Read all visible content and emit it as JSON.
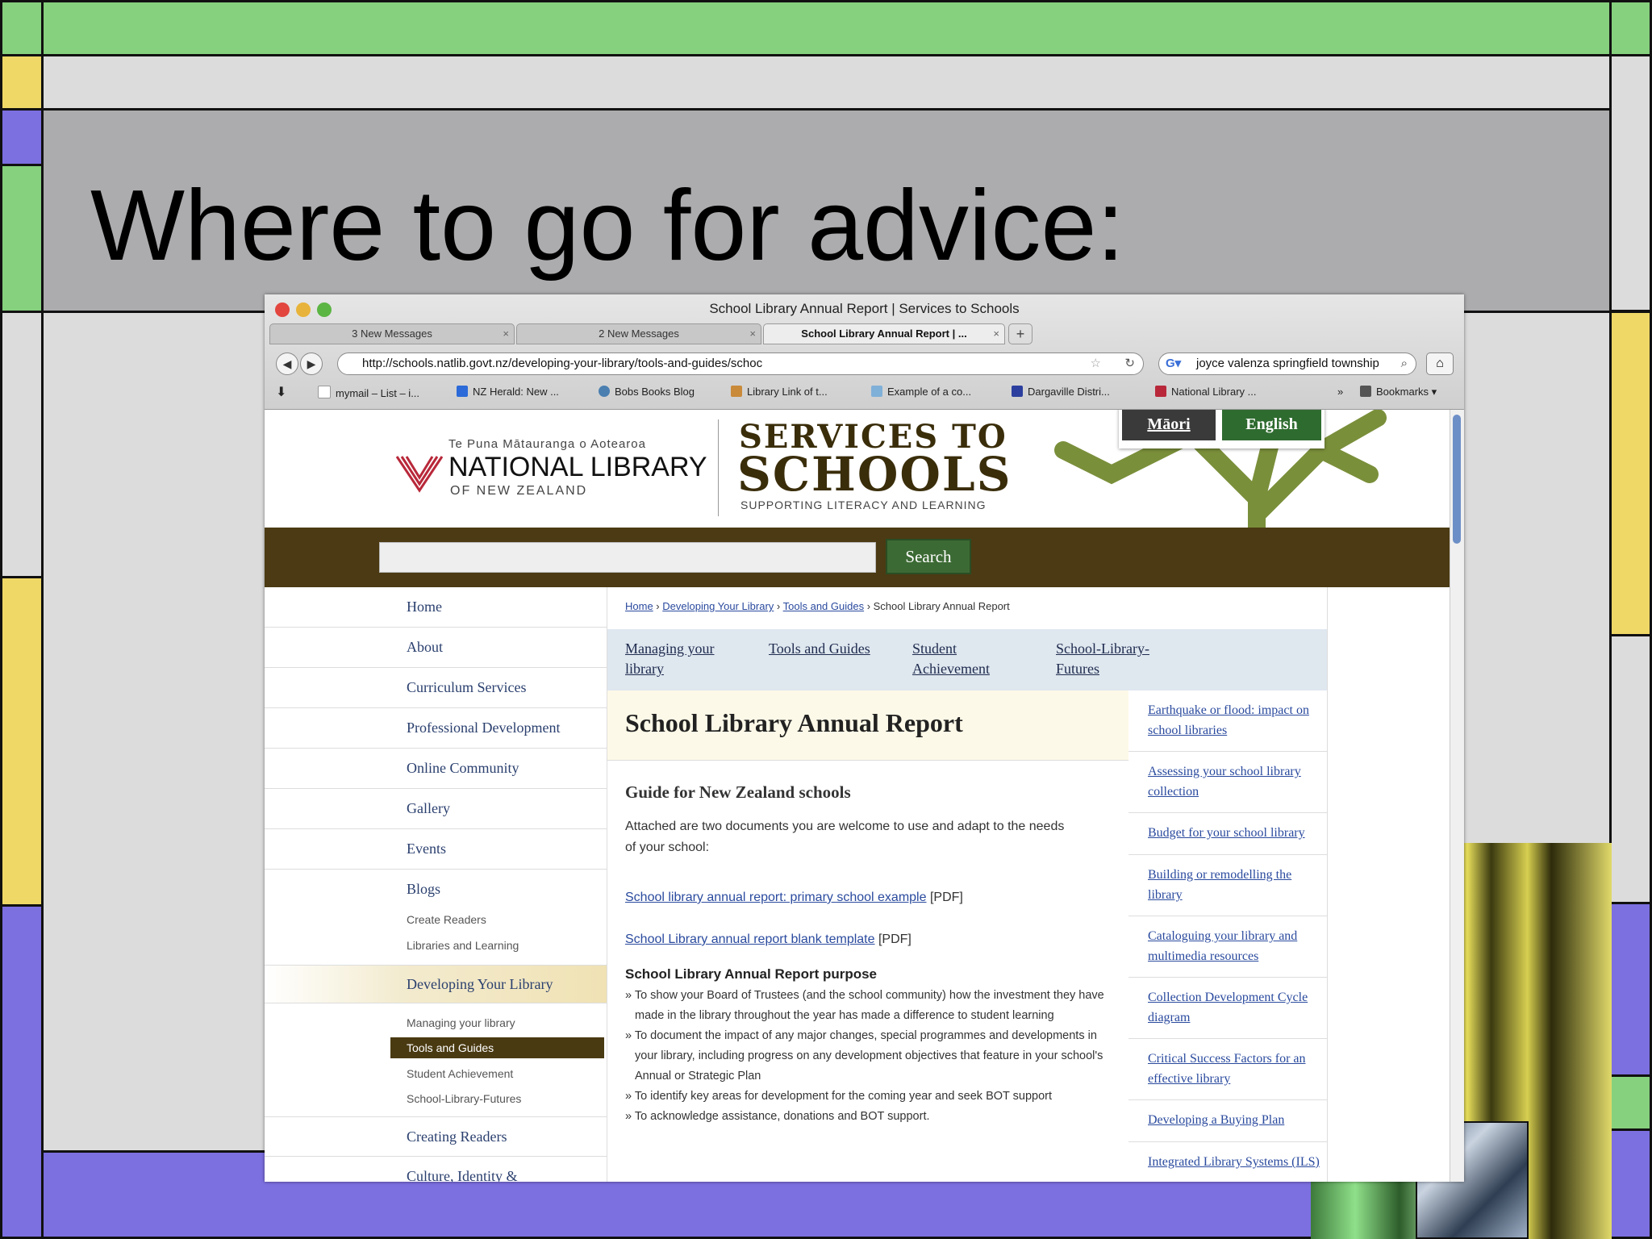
{
  "slide": {
    "title": "Where to go for advice:"
  },
  "browser": {
    "window_title": "School Library Annual Report | Services to Schools",
    "tabs": [
      {
        "label": "3 New Messages",
        "active": false
      },
      {
        "label": "2 New Messages",
        "active": false
      },
      {
        "label": "School Library Annual Report | ...",
        "active": true
      }
    ],
    "url": "http://schools.natlib.govt.nz/developing-your-library/tools-and-guides/schoc",
    "search_query": "joyce valenza springfield township",
    "bookmarks": [
      "mymail – List – i...",
      "NZ Herald: New ...",
      "Bobs Books Blog",
      "Library Link of t...",
      "Example of a co...",
      "Dargaville Distri...",
      "National Library ...",
      "Bookmarks"
    ]
  },
  "site": {
    "tagline_maori": "Te Puna Mātauranga o Aotearoa",
    "library_name": "NATIONAL LIBRARY",
    "library_sub": "OF NEW ZEALAND",
    "brand_line1": "SERVICES TO",
    "brand_line2": "SCHOOLS",
    "brand_tagline": "SUPPORTING LITERACY AND LEARNING",
    "lang_maori": "Māori",
    "lang_english": "English",
    "search_button": "Search"
  },
  "sidebar": {
    "items": [
      "Home",
      "About",
      "Curriculum Services",
      "Professional Development",
      "Online Community",
      "Gallery",
      "Events",
      "Blogs"
    ],
    "blog_subitems": [
      "Create Readers",
      "Libraries and Learning"
    ],
    "active_section": "Developing Your Library",
    "section_subitems": [
      "Managing your library",
      "Tools and Guides",
      "Student Achievement",
      "School-Library-Futures"
    ],
    "after_items": [
      "Creating Readers",
      "Culture, Identity &"
    ]
  },
  "breadcrumb": {
    "home": "Home",
    "developing": "Developing Your Library",
    "tools": "Tools and Guides",
    "current": "School Library Annual Report"
  },
  "subnav": {
    "managing_1": "Managing your",
    "managing_2": "library",
    "tools": "Tools and Guides",
    "student_1": "Student",
    "student_2": "Achievement",
    "futures_1": "School-Library-",
    "futures_2": "Futures"
  },
  "article": {
    "title": "School Library Annual Report",
    "subtitle": "Guide for New Zealand schools",
    "intro": "Attached are two documents you are welcome to use and adapt to the needs of your school:",
    "link1": "School library annual report:  primary school example",
    "link2": "School Library annual report blank template",
    "pdf": "[PDF]",
    "purpose_heading": "School Library Annual Report purpose",
    "bullets": [
      "» To show your Board of Trustees (and the school community) how the investment they have made in the library throughout the year has made a difference to student learning",
      "» To document the impact of any major changes, special programmes and developments in your library, including progress on any development objectives that feature in your school's Annual or Strategic Plan",
      "» To identify key areas for development for the coming year and seek BOT support",
      "» To acknowledge assistance, donations and BOT support."
    ]
  },
  "related": [
    "Earthquake or flood: impact on school libraries",
    "Assessing your school library collection",
    "Budget for your school library",
    "Building or remodelling the library",
    "Cataloguing your library and multimedia resources",
    "Collection Development Cycle diagram",
    "Critical Success Factors for an effective library",
    "Developing a Buying Plan",
    "Integrated Library Systems (ILS)"
  ],
  "colors": {
    "green": "#86d17e",
    "purple": "#7c6fe0",
    "yellow": "#efd866",
    "gray": "#acacae",
    "brown": "#4b3a13",
    "link": "#2a4a9e"
  }
}
